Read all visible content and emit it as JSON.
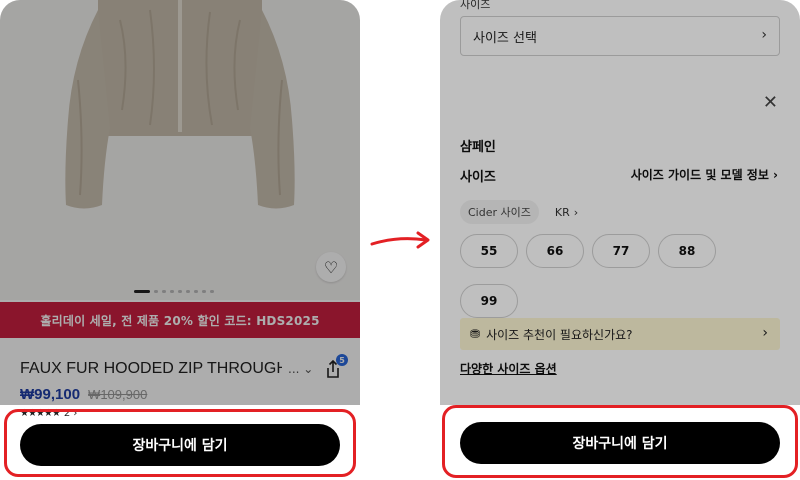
{
  "left_screen": {
    "sale_banner": "홀리데이 세일, 전 제품 20% 할인 코드: HDS2025",
    "product_title": "FAUX FUR HOODED ZIP THROUGH",
    "title_more": "... ⌄",
    "share_badge": "5",
    "price_sale": "₩99,100",
    "price_original": "₩109,900",
    "rating_stars": "★★★★★",
    "review_count": "2 ›",
    "wishlist_icon": "heart-icon",
    "add_to_cart_label": "장바구니에 담기",
    "carousel_total": 9,
    "carousel_active": 1
  },
  "right_screen": {
    "bg_top_text": "사이즈",
    "size_select_label": "사이즈 선택",
    "color_name": "샴페인",
    "size_label": "사이즈",
    "size_guide_label": "사이즈 가이드 및 모델 정보 ›",
    "size_system_cider": "Cider 사이즈",
    "size_system_kr": "KR",
    "sizes": [
      "55",
      "66",
      "77",
      "88",
      "99"
    ],
    "recommend_text": "사이즈 추천이 필요하신가요?",
    "size_options_link": "다양한 사이즈 옵션",
    "add_to_cart_label": "장바구니에 담기"
  },
  "colors": {
    "sale_banner_bg": "#cc1f42",
    "sale_price": "#1f3fa8",
    "highlight_border": "#e32024",
    "cta_bg": "#000000",
    "recommend_bg": "#fdf6d3"
  }
}
